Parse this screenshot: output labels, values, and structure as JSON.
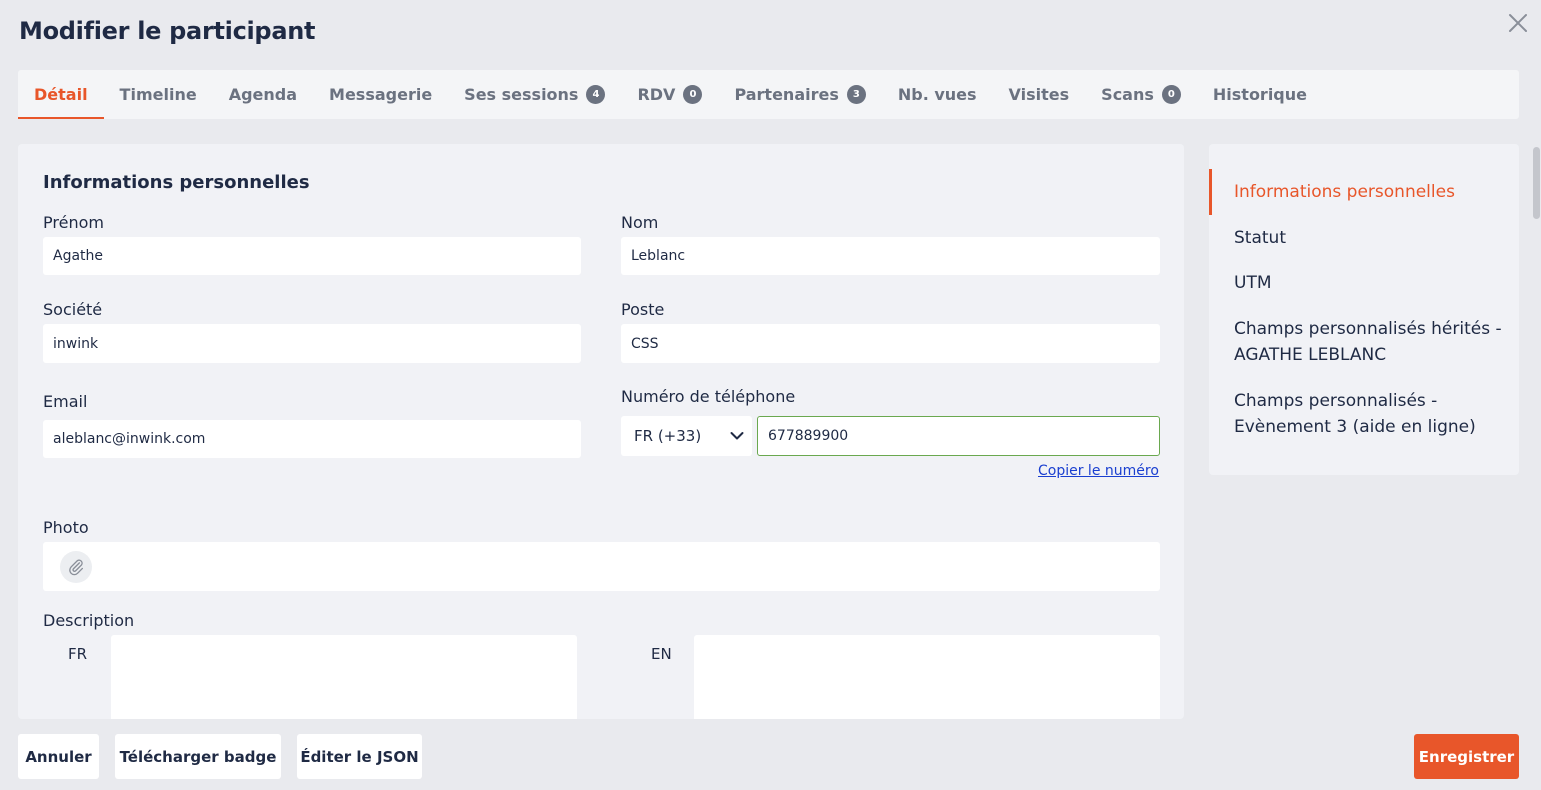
{
  "header": {
    "title": "Modifier le participant"
  },
  "tabs": [
    {
      "label": "Détail",
      "active": true
    },
    {
      "label": "Timeline"
    },
    {
      "label": "Agenda"
    },
    {
      "label": "Messagerie"
    },
    {
      "label": "Ses sessions",
      "count": "4"
    },
    {
      "label": "RDV",
      "count": "0"
    },
    {
      "label": "Partenaires",
      "count": "3"
    },
    {
      "label": "Nb. vues"
    },
    {
      "label": "Visites"
    },
    {
      "label": "Scans",
      "count": "0"
    },
    {
      "label": "Historique"
    }
  ],
  "form": {
    "section_title": "Informations personnelles",
    "prenom": {
      "label": "Prénom",
      "value": "Agathe"
    },
    "nom": {
      "label": "Nom",
      "value": "Leblanc"
    },
    "societe": {
      "label": "Société",
      "value": "inwink"
    },
    "poste": {
      "label": "Poste",
      "value": "CSS"
    },
    "email": {
      "label": "Email",
      "value": "aleblanc@inwink.com"
    },
    "phone": {
      "label": "Numéro de téléphone",
      "country": "FR (+33)",
      "value": "677889900",
      "copy_link": "Copier le numéro"
    },
    "photo": {
      "label": "Photo"
    },
    "description": {
      "label": "Description",
      "lang_fr": "FR",
      "lang_en": "EN"
    }
  },
  "side_nav": {
    "items": [
      {
        "label": "Informations personnelles",
        "active": true
      },
      {
        "label": "Statut"
      },
      {
        "label": "UTM"
      },
      {
        "label": "Champs personnalisés hérités - AGATHE LEBLANC"
      },
      {
        "label": "Champs personnalisés - Evènement 3 (aide en ligne)"
      }
    ]
  },
  "footer": {
    "cancel": "Annuler",
    "download_badge": "Télécharger badge",
    "edit_json": "Éditer le JSON",
    "save": "Enregistrer"
  },
  "colors": {
    "accent": "#e8562a",
    "focus_border": "#6aa84f",
    "link": "#1a3fd0"
  }
}
